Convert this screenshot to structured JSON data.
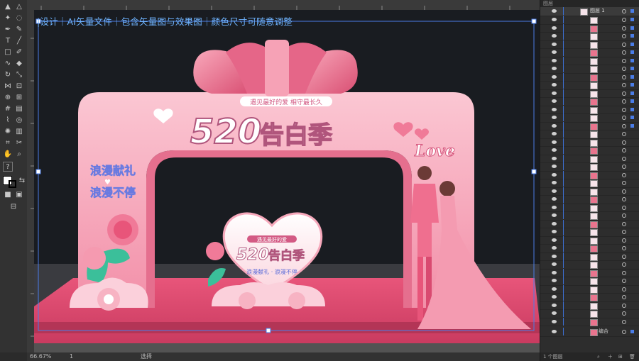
{
  "document": {
    "caption": "|设计｜AI矢量文件｜包含矢量图与效果图｜颜色尺寸可随意调整"
  },
  "artwork": {
    "main_title": "520",
    "main_title_cn": "告白季",
    "banner_text": "遇见最好的爱 相守最长久",
    "left_slogan_line1": "浪漫献礼",
    "left_slogan_line2": "浪漫不停",
    "love_text": "Love",
    "heart_sign_title": "520",
    "heart_sign_title_cn": "告白季",
    "heart_sign_sub": "浪漫献礼 · 浪漫不停",
    "heart_sign_top": "遇见最好的爱"
  },
  "statusbar": {
    "zoom": "66.67%",
    "artboard_num": "1",
    "tool_name": "选择"
  },
  "layers_panel": {
    "tab_label": "图层",
    "top_layer_name": "图层 1",
    "group_label": "编合",
    "footer_count": "1 个图层"
  },
  "colors": {
    "accent": "#f08aa3",
    "deep_pink": "#e8557a",
    "selection_blue": "#4a7de8",
    "caption_blue": "#6fb4ff"
  }
}
